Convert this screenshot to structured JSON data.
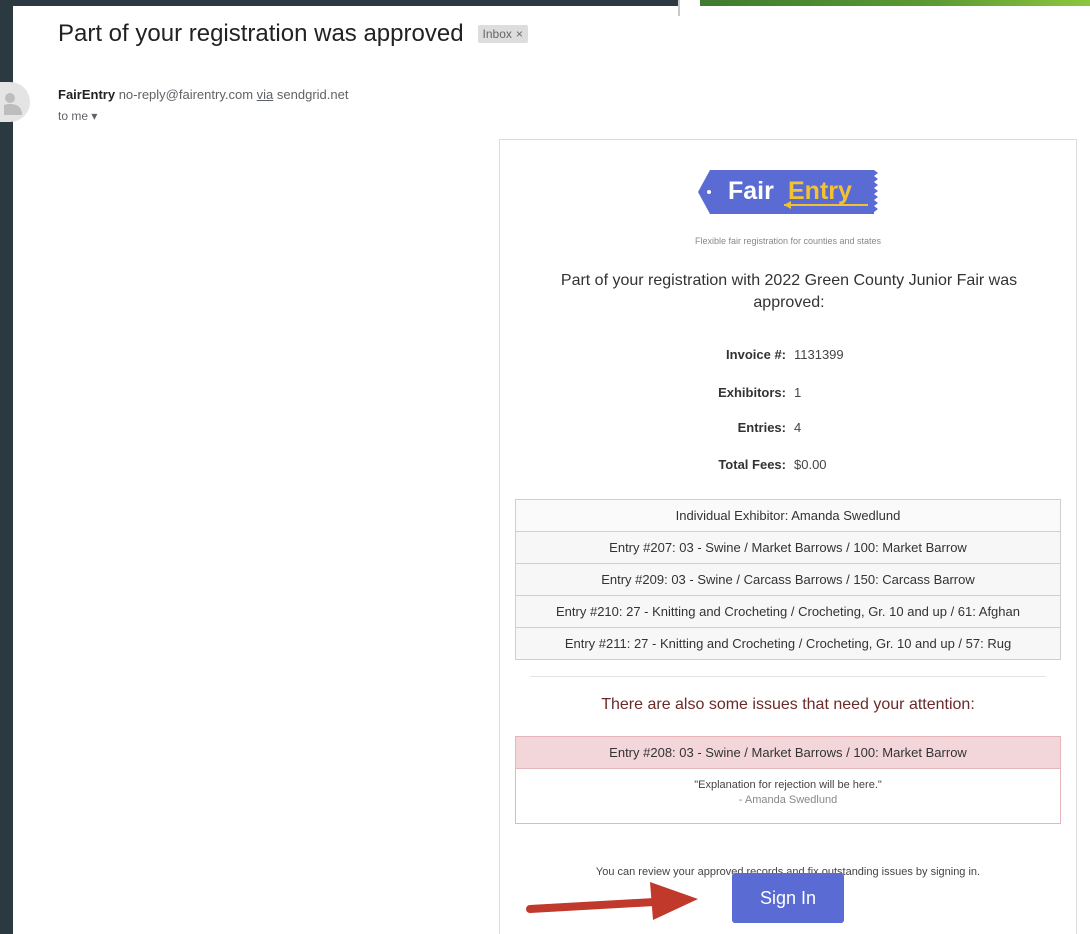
{
  "email": {
    "subject": "Part of your registration was approved",
    "label_badge": "Inbox",
    "label_close": "×",
    "sender_name": "FairEntry",
    "sender_email": "no-reply@fairentry.com",
    "via_label": "via",
    "via_domain": "sendgrid.net",
    "recipient": "to me",
    "recipient_caret": "▾"
  },
  "card": {
    "logo_text_fair": "Fair",
    "logo_text_entry": "Entry",
    "tagline": "Flexible fair registration for counties and states",
    "headline": "Part of your registration with 2022 Green County Junior Fair was approved:",
    "summary": [
      {
        "label": "Invoice #:",
        "value": "1131399"
      },
      {
        "label": "Exhibitors:",
        "value": "1"
      },
      {
        "label": "Entries:",
        "value": "4"
      },
      {
        "label": "Total Fees:",
        "value": "$0.00"
      }
    ],
    "table_rows": [
      "Individual Exhibitor: Amanda Swedlund",
      "Entry #207: 03 - Swine / Market Barrows / 100: Market Barrow",
      "Entry #209: 03 - Swine / Carcass Barrows / 150: Carcass Barrow",
      "Entry #210: 27 - Knitting and Crocheting / Crocheting, Gr. 10 and up / 61: Afghan",
      "Entry #211: 27 - Knitting and Crocheting / Crocheting, Gr. 10 and up / 57: Rug"
    ],
    "issues_title": "There are also some issues that need your attention:",
    "issue": {
      "entry": "Entry #208: 03 - Swine / Market Barrows / 100: Market Barrow",
      "quote": "\"Explanation for rejection will be here.\"",
      "author": "- Amanda Swedlund"
    },
    "review_note": "You can review your approved records and fix outstanding issues by signing in.",
    "signin_label": "Sign In"
  },
  "colors": {
    "button": "#5a6bd4",
    "logo_bg": "#5a6bd4",
    "logo_accent": "#f2c230",
    "arrow": "#c0392b",
    "issue_bg": "#f3d6da"
  }
}
